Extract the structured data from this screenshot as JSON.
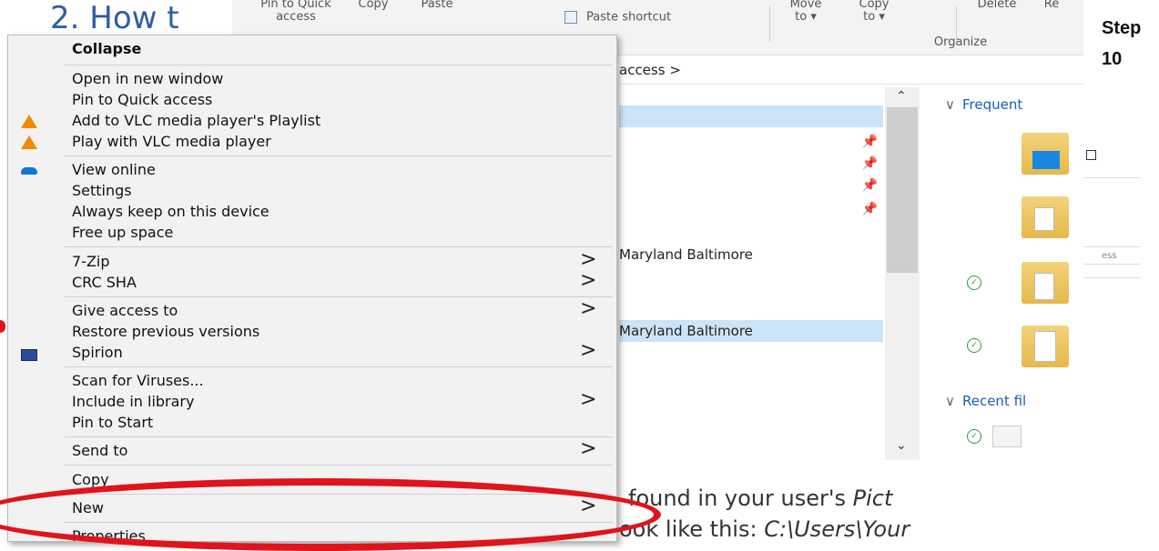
{
  "doc": {
    "heading": "2. How t",
    "step_label": "Step",
    "step_number": "10",
    "line1_visible": "found in your user's ",
    "line1_italic": "Pict",
    "line2_visible": "ook like this: ",
    "line2_italic": "C:\\Users\\Your"
  },
  "explorer": {
    "ribbon": {
      "pin_to_quick": "Pin to Quick",
      "access": "access",
      "copy": "Copy",
      "paste": "Paste",
      "paste_shortcut": "Paste shortcut",
      "move": "Move",
      "move_to": "to ▾",
      "copy_top": "Copy",
      "copy_to": "to ▾",
      "delete": "Delete",
      "rename": "Re",
      "organize": "Organize"
    },
    "address": "access  >",
    "nav": {
      "row1": "Maryland Baltimore",
      "row2": "Maryland Baltimore"
    },
    "sections": {
      "frequent": "Frequent",
      "recent": "Recent fil"
    },
    "snippet": "ess"
  },
  "menu": {
    "items": [
      {
        "label": "Collapse"
      },
      {
        "label": "Open in new window"
      },
      {
        "label": "Pin to Quick access"
      },
      {
        "label": "Add to VLC media player's Playlist"
      },
      {
        "label": "Play with VLC media player"
      },
      {
        "label": "View online"
      },
      {
        "label": "Settings"
      },
      {
        "label": "Always keep on this device"
      },
      {
        "label": "Free up space"
      },
      {
        "label": "7-Zip"
      },
      {
        "label": "CRC SHA"
      },
      {
        "label": "Give access to"
      },
      {
        "label": "Restore previous versions"
      },
      {
        "label": "Spirion"
      },
      {
        "label": "Scan for Viruses..."
      },
      {
        "label": "Include in library"
      },
      {
        "label": "Pin to Start"
      },
      {
        "label": "Send to"
      },
      {
        "label": "Copy"
      },
      {
        "label": "New"
      },
      {
        "label": "Properties"
      }
    ],
    "submenu_arrow": ">",
    "icons": {
      "vlc": "vlc-icon",
      "onedrive": "onedrive-cloud-icon",
      "spirion": "spirion-icon"
    }
  },
  "annotation": {
    "highlight_color": "#e0141b",
    "highlighted_item": "New"
  }
}
